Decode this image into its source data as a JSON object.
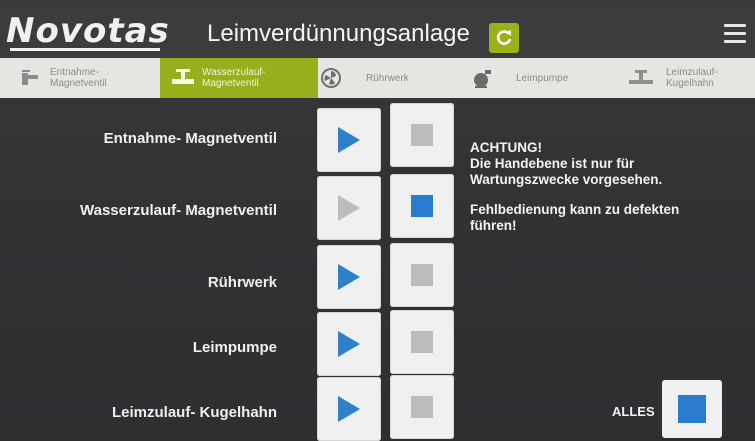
{
  "header": {
    "logo": "Novotas",
    "title": "Leimverdünnungsanlage",
    "refresh_icon": "refresh-icon",
    "menu_icon": "hamburger-menu-icon",
    "accent_color": "#98ae1c"
  },
  "tabs": [
    {
      "label_line1": "Entnahme-",
      "label_line2": "Magnetventil",
      "icon": "faucet-icon",
      "active": false
    },
    {
      "label_line1": "Wasserzulauf-",
      "label_line2": "Magnetventil",
      "icon": "valve-icon",
      "active": true
    },
    {
      "label_line1": "Rührwerk",
      "label_line2": "",
      "icon": "fan-icon",
      "active": false
    },
    {
      "label_line1": "Leimpumpe",
      "label_line2": "",
      "icon": "pump-icon",
      "active": false
    },
    {
      "label_line1": "Leimzulauf-",
      "label_line2": "Kugelhahn",
      "icon": "ball-valve-icon",
      "active": false
    }
  ],
  "rows": [
    {
      "label": "Entnahme- Magnetventil",
      "start_state": "available",
      "stop_state": "off"
    },
    {
      "label": "Wasserzulauf- Magnetventil",
      "start_state": "disabled",
      "stop_state": "on"
    },
    {
      "label": "Rührwerk",
      "start_state": "available",
      "stop_state": "off"
    },
    {
      "label": "Leimpumpe",
      "start_state": "available",
      "stop_state": "off"
    },
    {
      "label": "Leimzulauf- Kugelhahn",
      "start_state": "available",
      "stop_state": "off"
    }
  ],
  "notice": {
    "heading": "ACHTUNG!",
    "line1": "Die Handebene  ist nur für",
    "line2": "Wartungszwecke vorgesehen.",
    "line3": "Fehlbedienung kann zu defekten",
    "line4": "führen!"
  },
  "alles": {
    "label": "ALLES"
  }
}
